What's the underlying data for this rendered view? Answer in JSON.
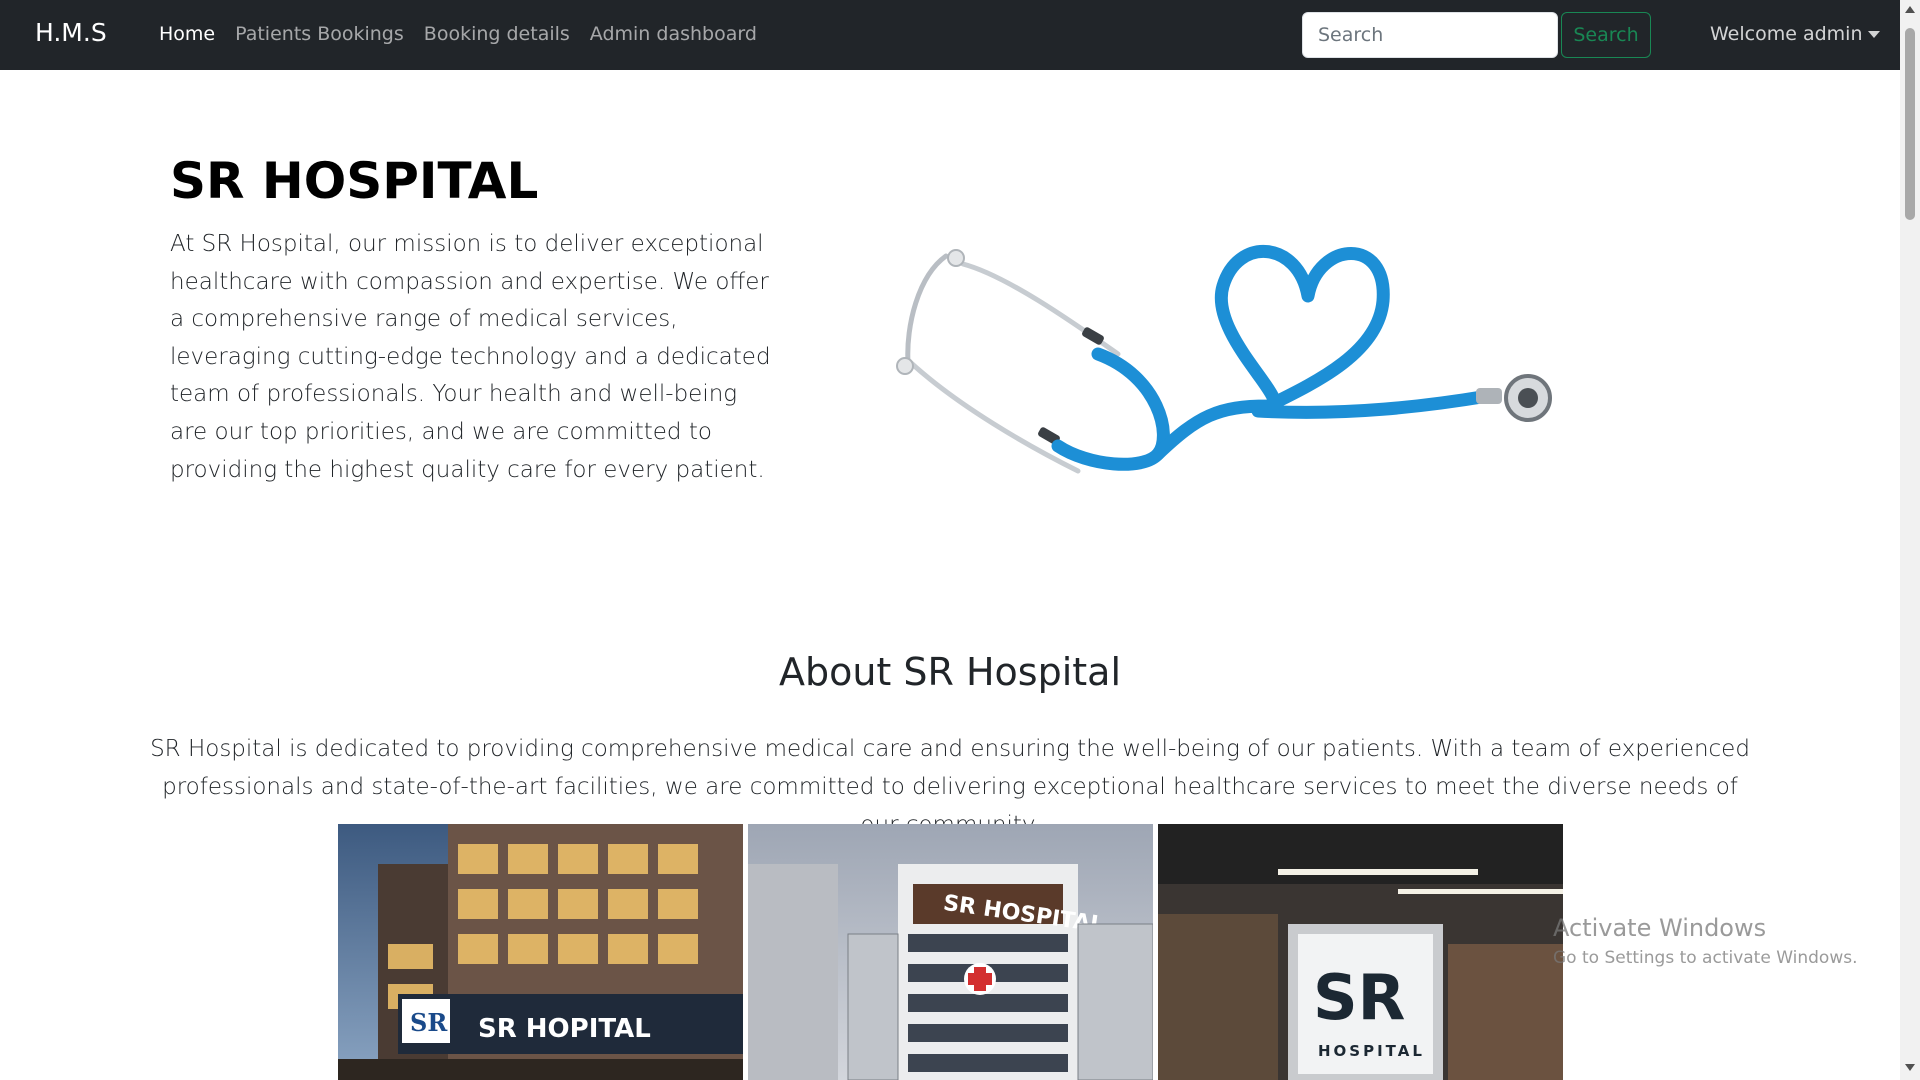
{
  "navbar": {
    "brand": "H.M.S",
    "links": [
      "Home",
      "Patients Bookings",
      "Booking details",
      "Admin dashboard"
    ],
    "search_placeholder": "Search",
    "search_button": "Search",
    "user_menu": "Welcome admin"
  },
  "hero": {
    "title": "SR HOSPITAL",
    "text": "At SR Hospital, our mission is to deliver exceptional healthcare with compassion and expertise. We offer a comprehensive range of medical services, leveraging cutting-edge technology and a dedicated team of professionals. Your health and well-being are our top priorities, and we are committed to providing the highest quality care for every patient.",
    "image_icon": "stethoscope-heart-icon"
  },
  "about": {
    "title": "About SR Hospital",
    "text": "SR Hospital is dedicated to providing comprehensive medical care and ensuring the well-being of our patients. With a team of experienced professionals and state-of-the-art facilities, we are committed to delivering exceptional healthcare services to meet the diverse needs of our community."
  },
  "gallery": {
    "photo1_sign": "SR HOPITAL",
    "photo1_logo": "SR",
    "photo2_sign": "SR HOSPITAL",
    "photo3_logo": "SR",
    "photo3_sub": "HOSPITAL"
  },
  "watermark": {
    "title": "Activate Windows",
    "subtitle": "Go to Settings to activate Windows."
  },
  "colors": {
    "navbar_bg": "#212529",
    "search_green": "#198754",
    "stethoscope_blue": "#1d8fd6"
  }
}
